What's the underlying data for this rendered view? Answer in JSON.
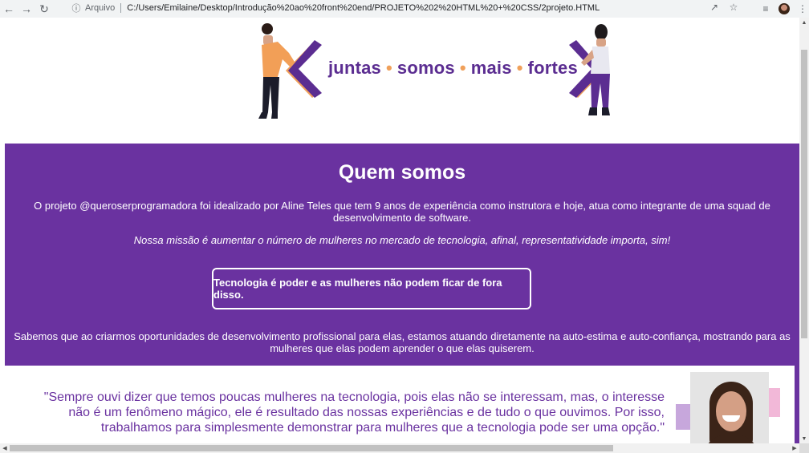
{
  "browser": {
    "address_prefix": "Arquivo",
    "url": "C:/Users/Emilaine/Desktop/Introdução%20ao%20front%20end/PROJETO%202%20HTML%20+%20CSS/2projeto.HTML"
  },
  "banner": {
    "words": [
      "juntas",
      "somos",
      "mais",
      "fortes"
    ],
    "separator": "•"
  },
  "section": {
    "title": "Quem somos",
    "intro": "O projeto @queroserprogramadora foi idealizado por Aline Teles que tem 9 anos de experiência como instrutora e hoje, atua como integrante de uma squad de desenvolvimento de software.",
    "mission": "Nossa missão é aumentar o número de mulheres no mercado de tecnologia, afinal, representatividade importa, sim!",
    "highlight": "Tecnologia é poder e as mulheres não podem ficar de fora disso.",
    "paragraph2": "Sabemos que ao criarmos oportunidades de desenvolvimento profissional para elas, estamos atuando diretamente na auto-estima e auto-confiança, mostrando para as mulheres que elas podem aprender o que elas quiserem."
  },
  "testimonial": {
    "quote": "\"Sempre ouvi dizer que temos poucas mulheres na tecnologia, pois elas não se interessam, mas, o interesse não é um fenômeno mágico, ele é resultado das nossas experiências e de tudo o que ouvimos. Por isso, trabalhamos para simplesmente demonstrar para mulheres que a tecnologia pode ser uma opção.\""
  },
  "colors": {
    "brand_purple": "#6a32a0",
    "accent_orange": "#f0a05a"
  },
  "icons": [
    "back-arrow-icon",
    "forward-arrow-icon",
    "reload-icon",
    "info-icon",
    "share-icon",
    "star-icon",
    "reading-list-icon",
    "kebab-menu-icon"
  ]
}
